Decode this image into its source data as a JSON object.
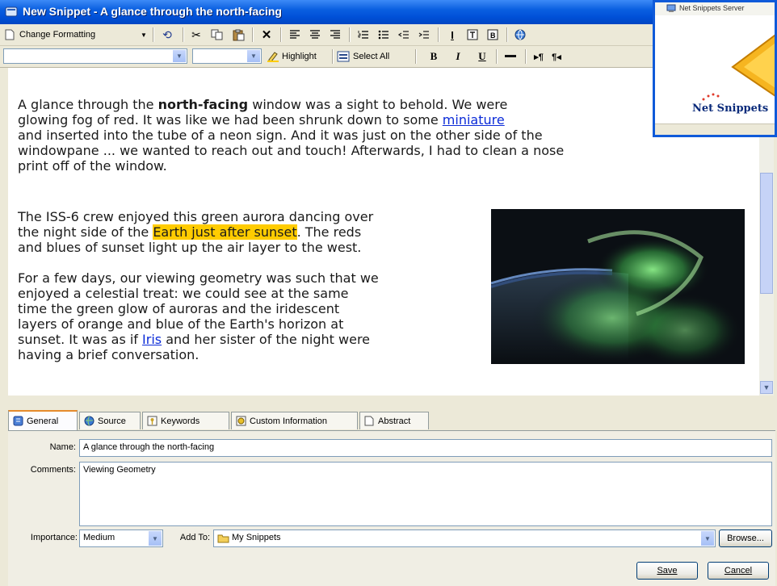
{
  "window": {
    "title": "New Snippet - A glance through the north-facing"
  },
  "toolbar1": {
    "change_formatting": "Change Formatting"
  },
  "toolbar2": {
    "highlight": "Highlight",
    "select_all": "Select All",
    "bold": "B",
    "italic": "I",
    "underline": "U"
  },
  "content": {
    "p1_a": "A glance through the ",
    "p1_bold": "north-facing",
    "p1_b": " window was a sight to behold. We were",
    "p2_a": "glowing fog of red. It was like we had been shrunk down to some ",
    "p2_link": "miniature",
    "p3": "and inserted into the tube of a neon sign. And it was just on the other side of the",
    "p4": "windowpane ... we wanted to reach out and touch! Afterwards, I had to clean a nose",
    "p5": "print off of the window.",
    "q1": "The ISS-6 crew enjoyed this green aurora dancing over",
    "q2_a": "the night side of the ",
    "q2_hl": "Earth just after sunset",
    "q2_b": ". The reds",
    "q3": "and blues of sunset light up the air layer to the west.",
    "r1": "For a few days, our viewing geometry was such that we",
    "r2": "enjoyed a celestial treat: we could see at the same",
    "r3": "time the green glow of auroras and the iridescent",
    "r4": "layers of orange and blue of the Earth's horizon at",
    "r5_a": "sunset. It was as if ",
    "r5_link": "Iris",
    "r5_b": " and her sister of the night were",
    "r6": "having a brief conversation."
  },
  "tabs": [
    {
      "label": "General"
    },
    {
      "label": "Source"
    },
    {
      "label": "Keywords"
    },
    {
      "label": "Custom Information"
    },
    {
      "label": "Abstract"
    }
  ],
  "form": {
    "name_label": "Name:",
    "name_value": "A glance through the north-facing",
    "comments_label": "Comments:",
    "comments_value": "Viewing Geometry",
    "importance_label": "Importance:",
    "importance_value": "Medium",
    "addto_label": "Add To:",
    "addto_value": "My Snippets",
    "browse_label": "Browse...",
    "save_label": "Save",
    "cancel_label": "Cancel"
  },
  "server_window": {
    "title": "Net Snippets Server",
    "brand": "Net Snippets"
  },
  "colors": {
    "highlight": "#ffcc00",
    "link": "#0b2bd8",
    "titlebar": "#0050d8",
    "aurora": "#5fd36a"
  }
}
